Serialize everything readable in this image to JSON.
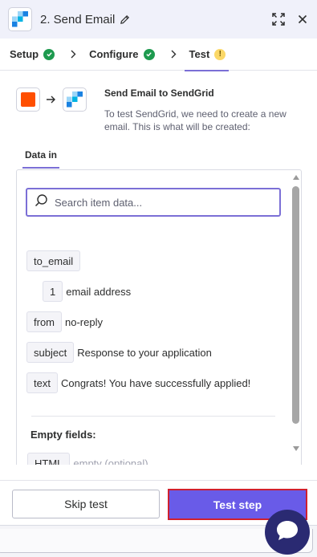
{
  "header": {
    "title": "2. Send Email",
    "icons": [
      "sendgrid-logo-icon",
      "pencil-icon",
      "expand-icon",
      "close-icon"
    ]
  },
  "tabs": [
    {
      "label": "Setup",
      "status": "complete"
    },
    {
      "label": "Configure",
      "status": "complete"
    },
    {
      "label": "Test",
      "status": "warning",
      "badge": "!"
    }
  ],
  "summary": {
    "title": "Send Email to SendGrid",
    "description": "To test SendGrid, we need to create a new email. This is what will be created:"
  },
  "data_tab": {
    "label": "Data in"
  },
  "search": {
    "placeholder": "Search item data..."
  },
  "fields": [
    {
      "key": "to_email"
    },
    {
      "key": "1",
      "value": "email address"
    },
    {
      "key": "from",
      "value": "no-reply"
    },
    {
      "key": "subject",
      "value": "Response to your application"
    },
    {
      "key": "text",
      "value": "Congrats! You have successfully applied!"
    }
  ],
  "empty_fields": {
    "title": "Empty fields:",
    "items": [
      {
        "key": "HTML",
        "value": "empty (optional)"
      }
    ]
  },
  "footer": {
    "skip_label": "Skip test",
    "test_label": "Test step"
  },
  "colors": {
    "accent": "#695be8",
    "success": "#1e9a4f",
    "warning": "#fbd867",
    "zapier_orange": "#ff4f00",
    "highlight_border": "#d0202e",
    "chat_button": "#2a2a72"
  }
}
